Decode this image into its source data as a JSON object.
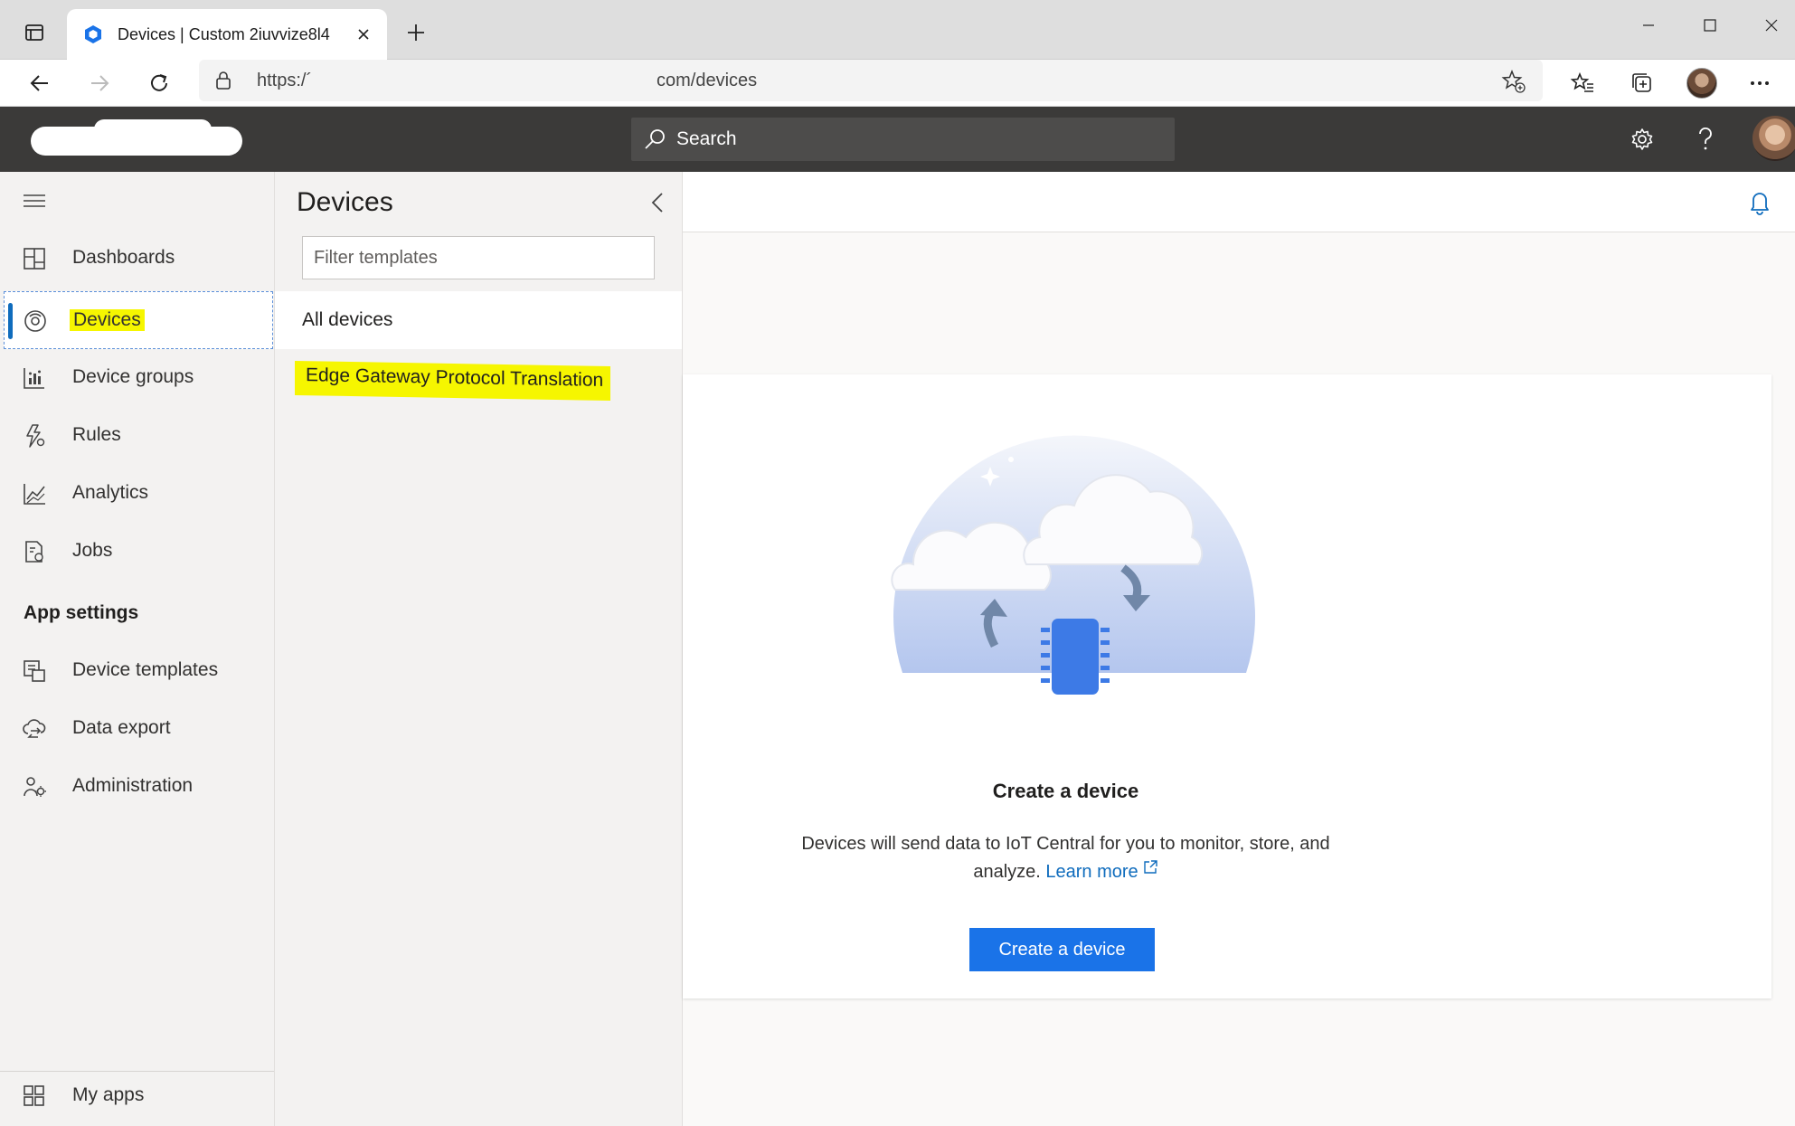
{
  "browser": {
    "tab_title": "Devices | Custom 2iuvvize8l4",
    "url_visible_prefix": "https:/´",
    "url_visible_suffix": "com/devices"
  },
  "header": {
    "search_label": "Search"
  },
  "left_nav": {
    "items": [
      {
        "label": "Dashboards",
        "icon": "dashboard-icon"
      },
      {
        "label": "Devices",
        "icon": "devices-icon",
        "active": true
      },
      {
        "label": "Device groups",
        "icon": "device-groups-icon"
      },
      {
        "label": "Rules",
        "icon": "rules-icon"
      },
      {
        "label": "Analytics",
        "icon": "analytics-icon"
      },
      {
        "label": "Jobs",
        "icon": "jobs-icon"
      }
    ],
    "section_app_settings": "App settings",
    "settings_items": [
      {
        "label": "Device templates",
        "icon": "device-templates-icon"
      },
      {
        "label": "Data export",
        "icon": "data-export-icon"
      },
      {
        "label": "Administration",
        "icon": "administration-icon"
      }
    ],
    "bottom_item": {
      "label": "My apps",
      "icon": "my-apps-icon"
    }
  },
  "devices_panel": {
    "title": "Devices",
    "filter_placeholder": "Filter templates",
    "all_devices": "All devices",
    "templates": [
      "Edge Gateway Protocol Translation"
    ]
  },
  "main": {
    "empty_title": "Create a device",
    "empty_desc": "Devices will send data to IoT Central for you to monitor, store, and analyze.",
    "learn_more": "Learn more",
    "create_button": "Create a device"
  },
  "colors": {
    "app_header": "#3b3a39",
    "accent": "#1a73e8",
    "highlight": "#f6f600",
    "nav_bg": "#f3f2f1"
  }
}
